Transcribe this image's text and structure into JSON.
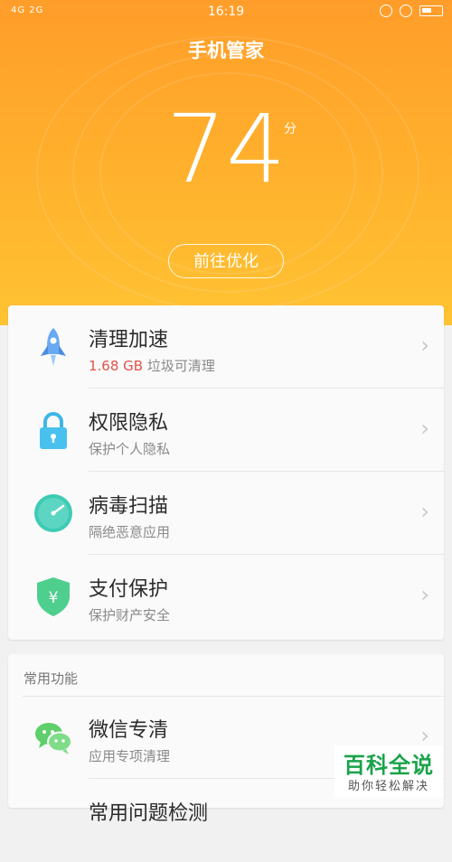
{
  "status_bar": {
    "network": "4G 2G",
    "time": "16:19"
  },
  "header": {
    "title": "手机管家",
    "score": "74",
    "score_unit": "分",
    "optimize_button": "前往优化"
  },
  "main_list": [
    {
      "title": "清理加速",
      "sub_highlight": "1.68 GB",
      "sub": " 垃圾可清理",
      "icon": "rocket-icon"
    },
    {
      "title": "权限隐私",
      "sub": "保护个人隐私",
      "icon": "lock-icon"
    },
    {
      "title": "病毒扫描",
      "sub": "隔绝恶意应用",
      "icon": "scan-clock-icon"
    },
    {
      "title": "支付保护",
      "sub": "保护财产安全",
      "icon": "yen-shield-icon"
    }
  ],
  "common": {
    "label": "常用功能",
    "items": [
      {
        "title": "微信专清",
        "sub": "应用专项清理",
        "icon": "wechat-icon"
      },
      {
        "title": "常用问题检测",
        "sub": "",
        "icon": ""
      }
    ]
  },
  "watermark": {
    "title": "百科全说",
    "sub": "助你轻松解决"
  }
}
